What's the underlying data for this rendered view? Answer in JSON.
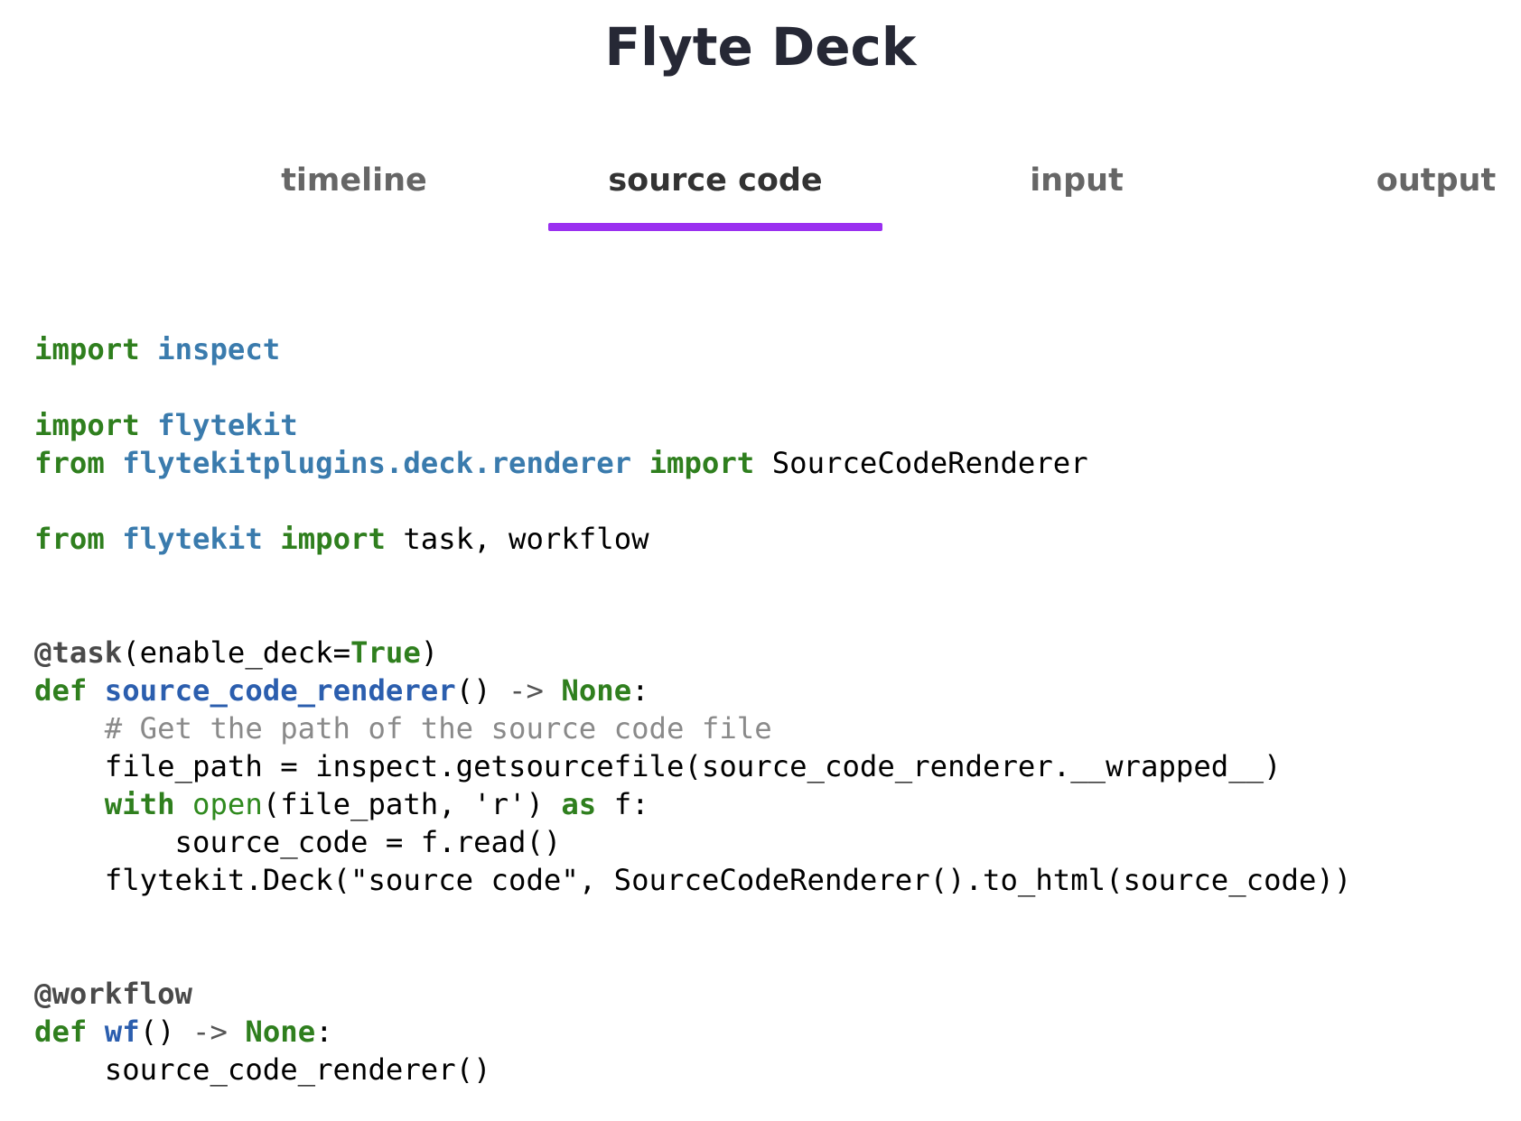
{
  "page": {
    "title": "Flyte Deck"
  },
  "tabs": [
    {
      "label": "timeline",
      "active": false
    },
    {
      "label": "source code",
      "active": true
    },
    {
      "label": "input",
      "active": false
    },
    {
      "label": "output",
      "active": false
    }
  ],
  "colors": {
    "tab_underline": "#9a30f0",
    "keyword": "#2f7f1e",
    "module": "#3a7bad",
    "function_name": "#2b5eae",
    "comment": "#8a8a8a",
    "title": "#262835"
  },
  "code": {
    "language": "python",
    "lines": [
      "import inspect",
      "",
      "import flytekit",
      "from flytekitplugins.deck.renderer import SourceCodeRenderer",
      "",
      "from flytekit import task, workflow",
      "",
      "",
      "@task(enable_deck=True)",
      "def source_code_renderer() -> None:",
      "    # Get the path of the source code file",
      "    file_path = inspect.getsourcefile(source_code_renderer.__wrapped__)",
      "    with open(file_path, 'r') as f:",
      "        source_code = f.read()",
      "    flytekit.Deck(\"source code\", SourceCodeRenderer().to_html(source_code))",
      "",
      "",
      "@workflow",
      "def wf() -> None:",
      "    source_code_renderer()"
    ]
  }
}
